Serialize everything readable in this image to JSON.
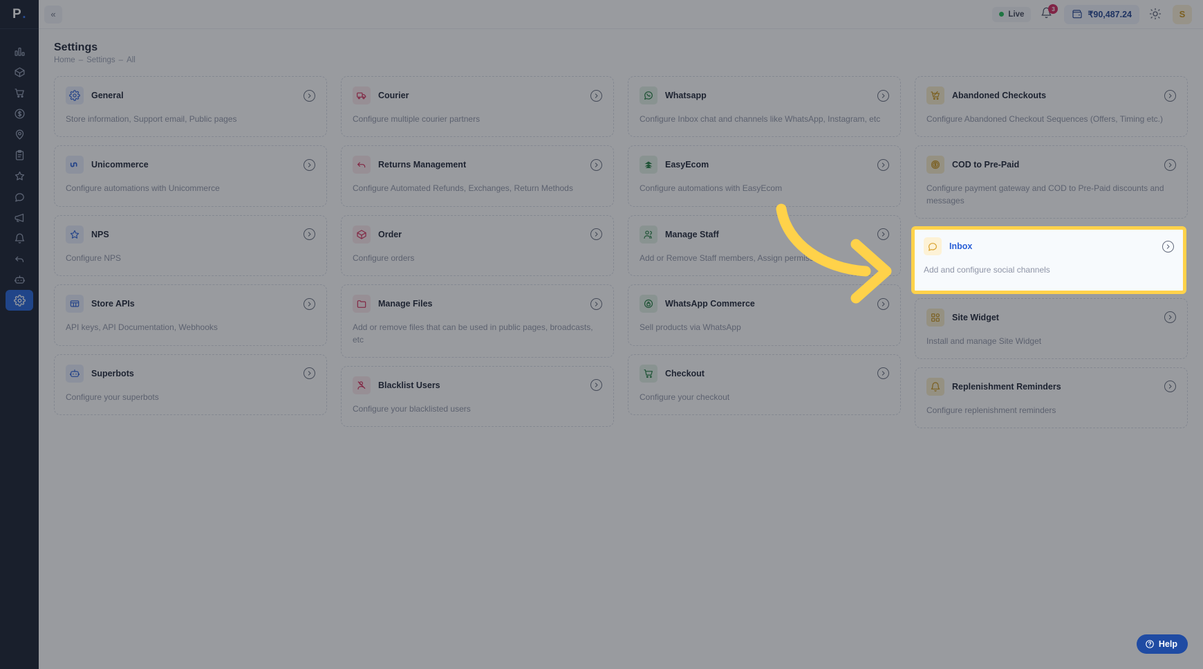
{
  "brand": {
    "logo": "P",
    "logo_dot": "."
  },
  "sidebar": {
    "collapse_label": "«",
    "items": [
      {
        "name": "analytics",
        "icon": "bar-chart-icon",
        "active": false
      },
      {
        "name": "products",
        "icon": "box-icon",
        "active": false
      },
      {
        "name": "abandoned-cart",
        "icon": "cart-icon",
        "active": false
      },
      {
        "name": "payments",
        "icon": "dollar-icon",
        "active": false
      },
      {
        "name": "locations",
        "icon": "pin-icon",
        "active": false
      },
      {
        "name": "orders",
        "icon": "clipboard-icon",
        "active": false
      },
      {
        "name": "reviews",
        "icon": "star-icon",
        "active": false
      },
      {
        "name": "inbox",
        "icon": "chat-icon",
        "active": false
      },
      {
        "name": "broadcasts",
        "icon": "megaphone-icon",
        "active": false
      },
      {
        "name": "reminders",
        "icon": "bell-icon",
        "active": false
      },
      {
        "name": "returns",
        "icon": "undo-icon",
        "active": false
      },
      {
        "name": "superbots",
        "icon": "robot-icon",
        "active": false
      },
      {
        "name": "settings",
        "icon": "gear-icon",
        "active": true
      }
    ]
  },
  "topbar": {
    "live_label": "Live",
    "notification_count": "3",
    "wallet_balance": "₹90,487.24",
    "avatar_initial": "S"
  },
  "header": {
    "title": "Settings",
    "breadcrumb": [
      "Home",
      "Settings",
      "All"
    ],
    "breadcrumb_separator": "–"
  },
  "columns": [
    {
      "cards": [
        {
          "title": "General",
          "desc": "Store information, Support email, Public pages",
          "icon": "gear-icon",
          "theme": "ic-blue",
          "highlight": false
        },
        {
          "title": "Unicommerce",
          "desc": "Configure automations with Unicommerce",
          "icon": "unicommerce-icon",
          "theme": "ic-blue",
          "highlight": false
        },
        {
          "title": "NPS",
          "desc": "Configure NPS",
          "icon": "star-icon",
          "theme": "ic-blue",
          "highlight": false
        },
        {
          "title": "Store APIs",
          "desc": "API keys, API Documentation, Webhooks",
          "icon": "api-icon",
          "theme": "ic-blue",
          "highlight": false
        },
        {
          "title": "Superbots",
          "desc": "Configure your superbots",
          "icon": "robot-icon",
          "theme": "ic-blue",
          "highlight": false
        }
      ]
    },
    {
      "cards": [
        {
          "title": "Courier",
          "desc": "Configure multiple courier partners",
          "icon": "truck-icon",
          "theme": "ic-red",
          "highlight": false
        },
        {
          "title": "Returns Management",
          "desc": "Configure Automated Refunds, Exchanges, Return Methods",
          "icon": "undo-icon",
          "theme": "ic-red",
          "highlight": false
        },
        {
          "title": "Order",
          "desc": "Configure orders",
          "icon": "box-icon",
          "theme": "ic-red",
          "highlight": false
        },
        {
          "title": "Manage Files",
          "desc": "Add or remove files that can be used in public pages, broadcasts, etc",
          "icon": "folder-icon",
          "theme": "ic-red",
          "highlight": false
        },
        {
          "title": "Blacklist Users",
          "desc": "Configure your blacklisted users",
          "icon": "user-block-icon",
          "theme": "ic-red",
          "highlight": false
        }
      ]
    },
    {
      "cards": [
        {
          "title": "Whatsapp",
          "desc": "Configure Inbox chat and channels like WhatsApp, Instagram, etc",
          "icon": "whatsapp-icon",
          "theme": "ic-green",
          "highlight": false
        },
        {
          "title": "EasyEcom",
          "desc": "Configure automations with EasyEcom",
          "icon": "easyecom-icon",
          "theme": "ic-green",
          "highlight": false
        },
        {
          "title": "Manage Staff",
          "desc": "Add or Remove Staff members, Assign permissions",
          "icon": "users-icon",
          "theme": "ic-green",
          "highlight": false
        },
        {
          "title": "WhatsApp Commerce",
          "desc": "Sell products via WhatsApp",
          "icon": "whatsapp-commerce-icon",
          "theme": "ic-green",
          "highlight": false
        },
        {
          "title": "Checkout",
          "desc": "Configure your checkout",
          "icon": "cart-icon",
          "theme": "ic-green",
          "highlight": false
        }
      ]
    },
    {
      "cards": [
        {
          "title": "Abandoned Checkouts",
          "desc": "Configure Abandoned Checkout Sequences (Offers, Timing etc.)",
          "icon": "abandoned-cart-icon",
          "theme": "ic-gold",
          "highlight": false
        },
        {
          "title": "COD to Pre-Paid",
          "desc": "Configure payment gateway and COD to Pre-Paid discounts and messages",
          "icon": "coin-icon",
          "theme": "ic-gold",
          "highlight": false
        },
        {
          "title": "Inbox",
          "desc": "Add and configure social channels",
          "icon": "chat-icon",
          "theme": "ic-inbox",
          "highlight": true
        },
        {
          "title": "Site Widget",
          "desc": "Install and manage Site Widget",
          "icon": "widget-icon",
          "theme": "ic-gold",
          "highlight": false
        },
        {
          "title": "Replenishment Reminders",
          "desc": "Configure replenishment reminders",
          "icon": "bell-icon",
          "theme": "ic-gold",
          "highlight": false
        }
      ]
    }
  ],
  "help": {
    "label": "Help",
    "icon": "question-circle-icon"
  },
  "annotation": {
    "type": "curved-arrow",
    "color": "#FFD24A"
  },
  "colors": {
    "accent_blue": "#2a5fd6",
    "highlight_yellow": "#FFD24A",
    "rail_bg": "#131a2b",
    "live_green": "#1db954",
    "badge_red": "#d1245b"
  }
}
